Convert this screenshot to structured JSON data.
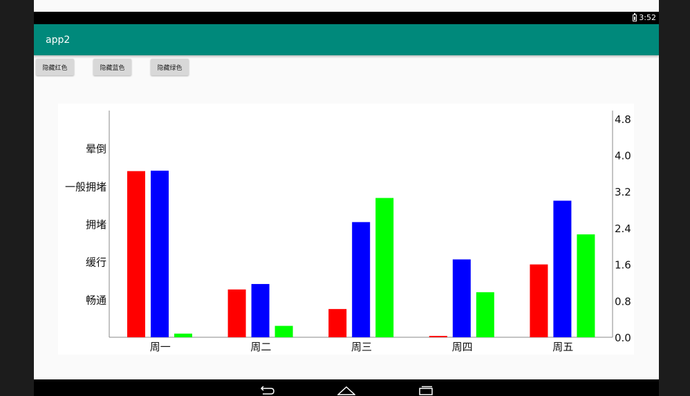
{
  "status_bar": {
    "time": "3:52",
    "battery_icon": "battery-charging-icon"
  },
  "app_bar": {
    "title": "app2"
  },
  "buttons": [
    {
      "label": "隐藏红色"
    },
    {
      "label": "隐藏蓝色"
    },
    {
      "label": "隐藏绿色"
    }
  ],
  "nav_bar": {
    "icons": [
      "back-icon",
      "home-icon",
      "recents-icon"
    ]
  },
  "colors": {
    "red": "#ff0000",
    "blue": "#0000ff",
    "green": "#00ff00",
    "app_bar": "#00897b"
  },
  "chart_data": {
    "type": "bar",
    "categories": [
      "周一",
      "周二",
      "周三",
      "周四",
      "周五"
    ],
    "series": [
      {
        "color": "#ff0000",
        "values": [
          3.65,
          1.05,
          0.62,
          0.03,
          1.6
        ]
      },
      {
        "color": "#0000ff",
        "values": [
          3.66,
          1.17,
          2.53,
          1.71,
          3.0
        ]
      },
      {
        "color": "#00ff00",
        "values": [
          0.08,
          0.25,
          3.06,
          0.99,
          2.26
        ]
      }
    ],
    "left_axis": {
      "labels": [
        "畅通",
        "缓行",
        "拥堵",
        "一般拥堵",
        "晕倒"
      ],
      "positions": [
        0.83,
        1.66,
        2.49,
        3.32,
        4.15
      ]
    },
    "right_axis": {
      "ticks": [
        "0.0",
        "0.8",
        "1.6",
        "2.4",
        "3.2",
        "4.0",
        "4.8"
      ]
    },
    "ylim": [
      0,
      4.98
    ]
  }
}
